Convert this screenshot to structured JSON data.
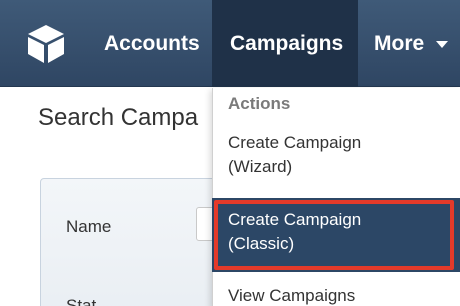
{
  "nav": {
    "logo_icon": "cube-icon",
    "accounts": "Accounts",
    "campaigns": "Campaigns",
    "more": "More"
  },
  "page": {
    "title": "Search Campa"
  },
  "search_form": {
    "name_label": "Name",
    "status_label": "Stat"
  },
  "dropdown": {
    "header": "Actions",
    "items": [
      {
        "label": "Create Campaign (Wizard)"
      },
      {
        "label": "Create Campaign (Classic)",
        "highlighted": true
      },
      {
        "label": "View Campaigns"
      }
    ]
  },
  "colors": {
    "navbar": "#2f4663",
    "active_tab": "#1f3148",
    "highlight_border": "#e43a2a",
    "selected_item": "#2c4766"
  }
}
